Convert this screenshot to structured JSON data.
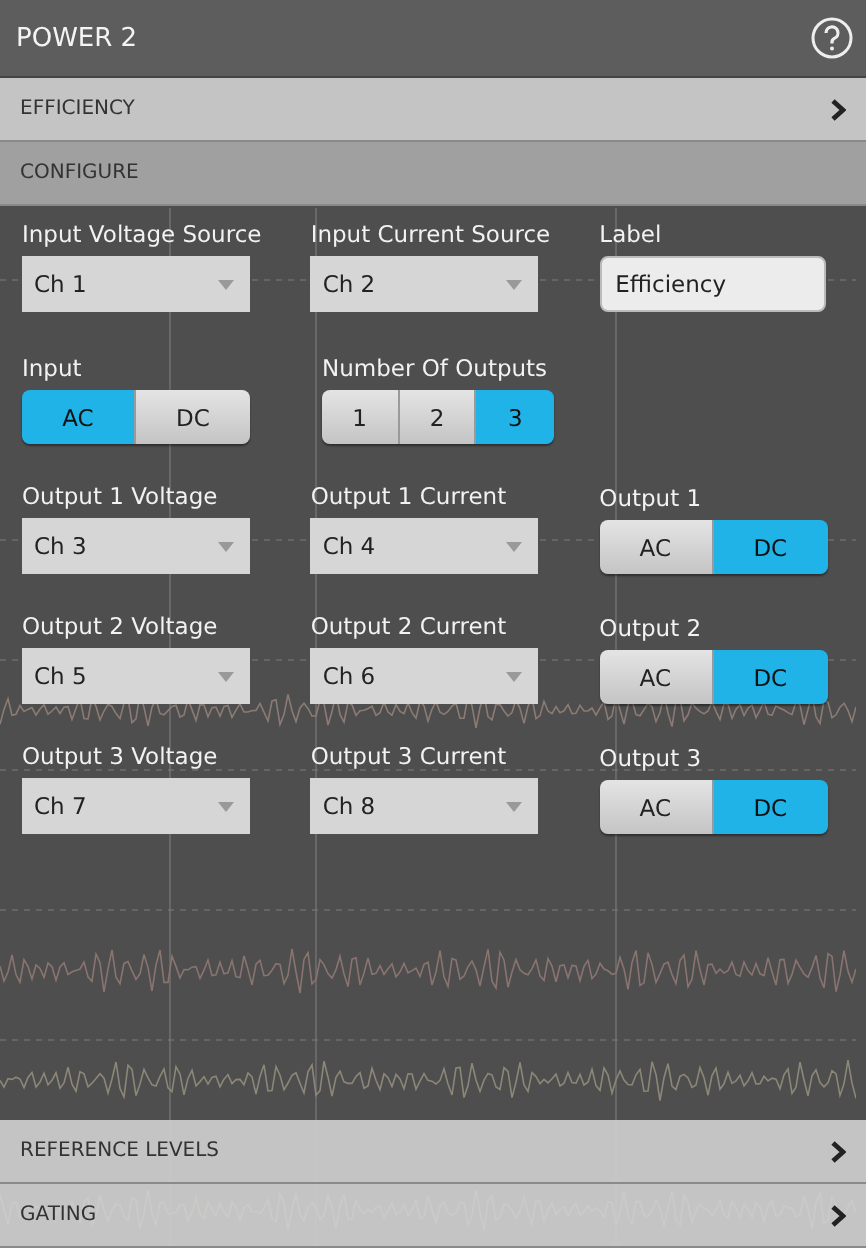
{
  "panel": {
    "title": "POWER 2"
  },
  "sections_top": [
    {
      "label": "EFFICIENCY",
      "kind": "link"
    },
    {
      "label": "CONFIGURE",
      "kind": "header"
    }
  ],
  "rows": [
    [
      {
        "kind": "dropdown",
        "label": "Input Voltage Source",
        "value": "Ch 1"
      },
      {
        "kind": "dropdown",
        "label": "Input Current Source",
        "value": "Ch 2"
      },
      {
        "kind": "text",
        "label": "Label",
        "value": "Efficiency"
      }
    ],
    [
      {
        "kind": "segmented",
        "label": "Input",
        "options": [
          {
            "label": "AC",
            "selected": true
          },
          {
            "label": "DC",
            "selected": false
          }
        ]
      },
      {
        "kind": "segmented",
        "label": "Number Of Outputs",
        "options": [
          {
            "label": "1",
            "selected": false
          },
          {
            "label": "2",
            "selected": false
          },
          {
            "label": "3",
            "selected": true
          }
        ]
      }
    ],
    [
      {
        "kind": "dropdown",
        "label": "Output 1 Voltage",
        "value": "Ch 3"
      },
      {
        "kind": "dropdown",
        "label": "Output 1 Current",
        "value": "Ch 4"
      },
      {
        "kind": "segmented",
        "label": "Output 1",
        "options": [
          {
            "label": "AC",
            "selected": false
          },
          {
            "label": "DC",
            "selected": true
          }
        ]
      }
    ],
    [
      {
        "kind": "dropdown",
        "label": "Output 2 Voltage",
        "value": "Ch 5"
      },
      {
        "kind": "dropdown",
        "label": "Output 2 Current",
        "value": "Ch 6"
      },
      {
        "kind": "segmented",
        "label": "Output 2",
        "options": [
          {
            "label": "AC",
            "selected": false
          },
          {
            "label": "DC",
            "selected": true
          }
        ]
      }
    ],
    [
      {
        "kind": "dropdown",
        "label": "Output 3 Voltage",
        "value": "Ch 7"
      },
      {
        "kind": "dropdown",
        "label": "Output 3 Current",
        "value": "Ch 8"
      },
      {
        "kind": "segmented",
        "label": "Output 3",
        "options": [
          {
            "label": "AC",
            "selected": false
          },
          {
            "label": "DC",
            "selected": true
          }
        ]
      }
    ]
  ],
  "sections_bottom": [
    {
      "label": "REFERENCE LEVELS",
      "kind": "link"
    },
    {
      "label": "GATING",
      "kind": "link"
    }
  ]
}
